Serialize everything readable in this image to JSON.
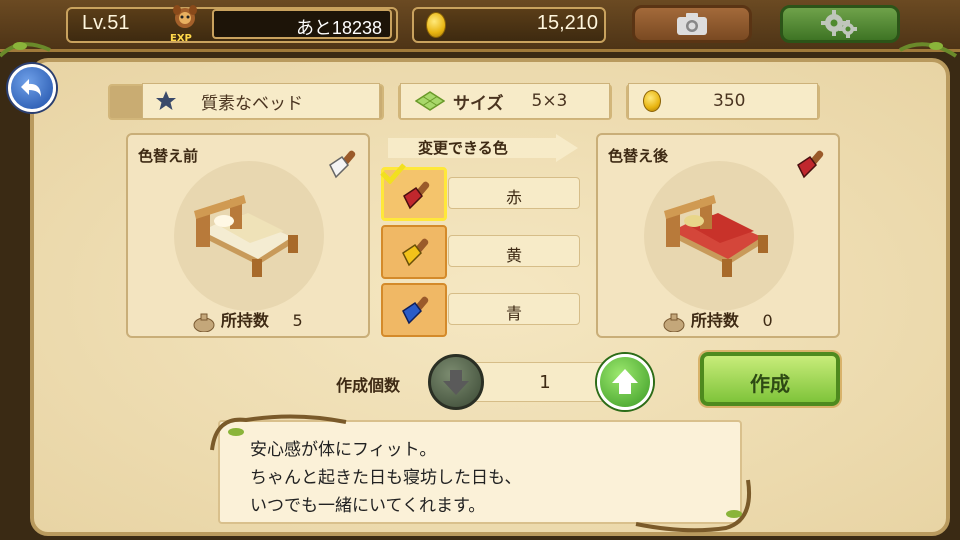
{
  "header": {
    "level": "Lv.51",
    "exp_badge": "EXP",
    "exp_remaining": "あと18238",
    "gold": "15,210",
    "camera_icon": "camera-icon",
    "settings_icon": "gear-icon"
  },
  "item": {
    "name": "質素なベッド",
    "size_label": "サイズ",
    "size_value": "5×3",
    "price": "350"
  },
  "before": {
    "title": "色替え前",
    "owned_label": "所持数",
    "owned_count": "5"
  },
  "after": {
    "title": "色替え後",
    "owned_label": "所持数",
    "owned_count": "0"
  },
  "colors": {
    "header": "変更できる色",
    "options": [
      {
        "label": "赤",
        "brush_color": "#c0272d",
        "selected": true
      },
      {
        "label": "黄",
        "brush_color": "#f2c21a",
        "selected": false
      },
      {
        "label": "青",
        "brush_color": "#2a5cc8",
        "selected": false
      }
    ]
  },
  "quantity": {
    "label": "作成個数",
    "value": "1"
  },
  "make_button": "作成",
  "description": {
    "line1": "安心感が体にフィット。",
    "line2": "ちゃんと起きた日も寝坊した日も、",
    "line3": "いつでも一緒にいてくれます。"
  },
  "colors_theme": {
    "accent_green": "#7fc43a",
    "panel_bg": "#f5e7c2",
    "back_blue": "#1e4fa8"
  }
}
